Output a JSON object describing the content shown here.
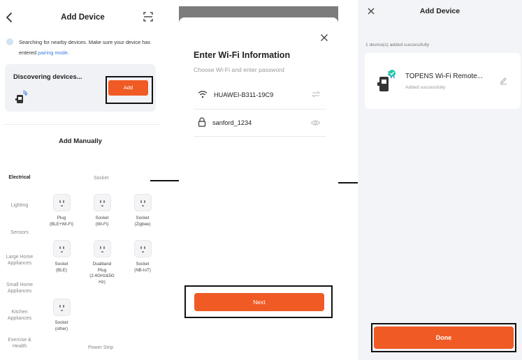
{
  "panel1": {
    "title": "Add Device",
    "info_text": "Searching for nearby devices. Make sure your device has entered ",
    "info_link": "pairing mode",
    "info_suffix": ".",
    "discovering_label": "Discovering devices...",
    "add_button": "Add",
    "add_manually_title": "Add Manually",
    "categories": [
      "Electrical",
      "Lighting",
      "Sensors",
      "Large Home Appliances",
      "Small Home Appliances",
      "Kitchen Appliances",
      "Exercise & Health"
    ],
    "section_socket": "Socket",
    "section_power_strip": "Power Strip",
    "devices": [
      {
        "label": "Plug\n(BLE+Wi-Fi)"
      },
      {
        "label": "Socket\n(Wi-Fi)"
      },
      {
        "label": "Socket\n(Zigbee)"
      },
      {
        "label": "Socket\n(BLE)"
      },
      {
        "label": "Dualband\nPlug\n(2.4GHz&5G\nHz)"
      },
      {
        "label": "Socket\n(NB-IoT)"
      },
      {
        "label": "Socket\n(other)"
      }
    ]
  },
  "panel2": {
    "title": "Enter Wi-Fi Information",
    "subtitle": "Choose Wi-Fi and enter password",
    "ssid": "HUAWEI-B311-19C9",
    "password": "sanford_1234",
    "next_button": "Next"
  },
  "panel3": {
    "title": "Add Device",
    "added_count": "1 device(s) added successfully",
    "device_name": "TOPENS Wi-Fi Remote...",
    "device_status": "Added successfully",
    "done_button": "Done"
  },
  "colors": {
    "accent": "#f05a24",
    "link": "#3a7ae0",
    "success": "#1ec8a5"
  },
  "icons": [
    "back-icon",
    "scan-icon",
    "info-icon",
    "device-icon",
    "socket-icon",
    "close-icon",
    "wifi-icon",
    "switch-network-icon",
    "lock-icon",
    "eye-icon",
    "edit-icon",
    "check-badge-icon",
    "arrow-icon"
  ]
}
